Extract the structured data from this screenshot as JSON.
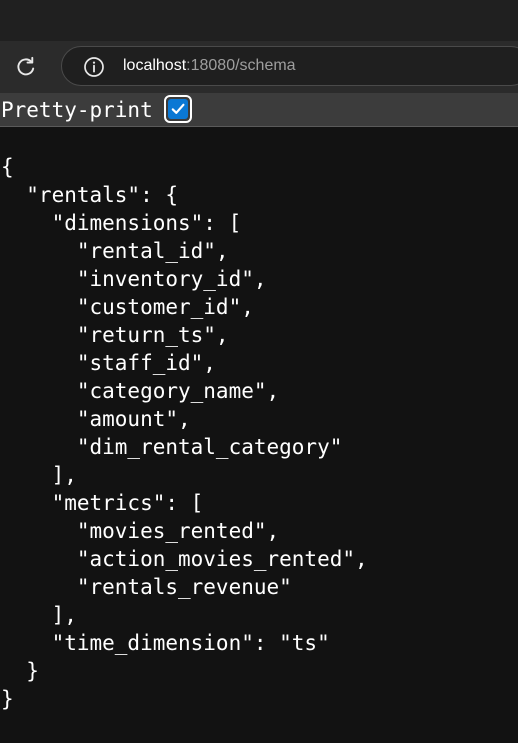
{
  "browser": {
    "url_host": "localhost",
    "url_rest": ":18080/schema"
  },
  "page": {
    "pretty_print_label": "Pretty-print",
    "pretty_print_checked": true,
    "json_lines": [
      "{",
      "  \"rentals\": {",
      "    \"dimensions\": [",
      "      \"rental_id\",",
      "      \"inventory_id\",",
      "      \"customer_id\",",
      "      \"return_ts\",",
      "      \"staff_id\",",
      "      \"category_name\",",
      "      \"amount\",",
      "      \"dim_rental_category\"",
      "    ],",
      "    \"metrics\": [",
      "      \"movies_rented\",",
      "      \"action_movies_rented\",",
      "      \"rentals_revenue\"",
      "    ],",
      "    \"time_dimension\": \"ts\"",
      "  }",
      "}"
    ]
  },
  "colors": {
    "checkbox_accent": "#0a78d4",
    "page_background": "#121212",
    "toolbar_background": "#2b2b2b"
  },
  "icons": {
    "reload": "reload-icon",
    "site_info": "info-icon",
    "checkmark": "checkmark-icon"
  }
}
